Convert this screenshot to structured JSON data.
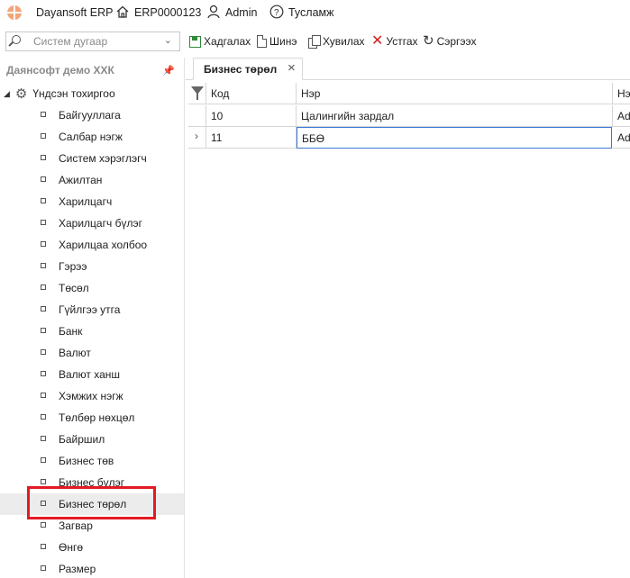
{
  "topbar": {
    "app_name": "Dayansoft ERP",
    "company_code": "ERP0000123",
    "user": "Admin",
    "help": "Тусламж"
  },
  "toolbar": {
    "search_placeholder": "Систем дугаар",
    "save": "Хадгалах",
    "new": "Шинэ",
    "copy": "Хувилах",
    "delete": "Устгах",
    "refresh": "Сэргээх"
  },
  "sidebar": {
    "title": "Даянсофт демо ХХК",
    "root": "Үндсэн тохиргоо",
    "items": [
      "Байгууллага",
      "Салбар нэгж",
      "Систем хэрэглэгч",
      "Ажилтан",
      "Харилцагч",
      "Харилцагч бүлэг",
      "Харилцаа холбоо",
      "Гэрээ",
      "Төсөл",
      "Гүйлгээ утга",
      "Банк",
      "Валют",
      "Валют ханш",
      "Хэмжих нэгж",
      "Төлбөр нөхцөл",
      "Байршил",
      "Бизнес төв",
      "Бизнес бүлэг",
      "Бизнес төрөл",
      "Загвар",
      "Өнгө",
      "Размер"
    ],
    "selected_index": 18
  },
  "tab": {
    "title": "Бизнес төрөл"
  },
  "grid": {
    "columns": [
      "Код",
      "Нэр",
      "Нэ"
    ],
    "rows": [
      {
        "code": "10",
        "name": "Цалингийн зардал",
        "extra": "Ad"
      },
      {
        "code": "11",
        "name": "ББӨ",
        "extra": "Ad"
      }
    ]
  }
}
